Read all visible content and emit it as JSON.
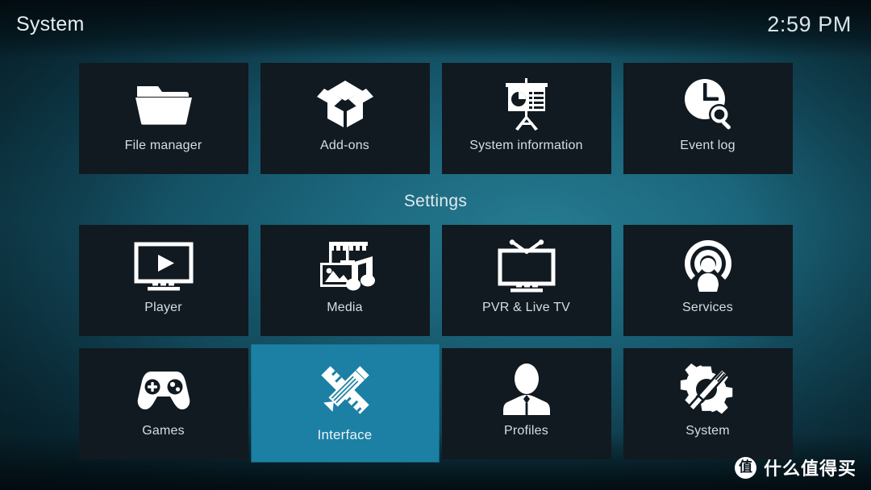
{
  "header": {
    "title": "System",
    "clock": "2:59 PM"
  },
  "section": {
    "settings_label": "Settings"
  },
  "theme": {
    "selection_color": "#1b80a4",
    "tile_color": "#111a20",
    "text_color": "#d4dfe3",
    "background_teal": "#134a5c"
  },
  "rows": [
    {
      "name": "top-row",
      "tiles": [
        {
          "id": "file-manager",
          "label": "File manager",
          "icon": "folder-icon",
          "selected": false
        },
        {
          "id": "add-ons",
          "label": "Add-ons",
          "icon": "open-box-icon",
          "selected": false
        },
        {
          "id": "system-information",
          "label": "System information",
          "icon": "presentation-icon",
          "selected": false
        },
        {
          "id": "event-log",
          "label": "Event log",
          "icon": "clock-search-icon",
          "selected": false
        }
      ]
    },
    {
      "name": "settings-row-1",
      "tiles": [
        {
          "id": "player",
          "label": "Player",
          "icon": "monitor-play-icon",
          "selected": false
        },
        {
          "id": "media",
          "label": "Media",
          "icon": "media-stack-icon",
          "selected": false
        },
        {
          "id": "pvr-live-tv",
          "label": "PVR & Live TV",
          "icon": "tv-antenna-icon",
          "selected": false
        },
        {
          "id": "services",
          "label": "Services",
          "icon": "broadcast-user-icon",
          "selected": false
        }
      ]
    },
    {
      "name": "settings-row-2",
      "tiles": [
        {
          "id": "games",
          "label": "Games",
          "icon": "gamepad-icon",
          "selected": false
        },
        {
          "id": "interface",
          "label": "Interface",
          "icon": "pencil-ruler-icon",
          "selected": true
        },
        {
          "id": "profiles",
          "label": "Profiles",
          "icon": "person-icon",
          "selected": false
        },
        {
          "id": "system",
          "label": "System",
          "icon": "gear-tools-icon",
          "selected": false
        }
      ]
    }
  ],
  "watermark": {
    "badge": "值",
    "text": "什么值得买"
  }
}
